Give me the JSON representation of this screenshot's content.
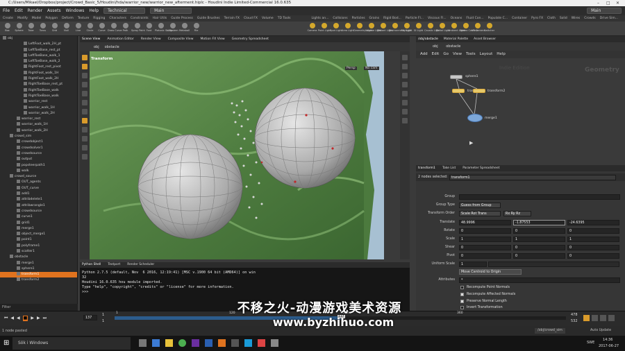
{
  "window": {
    "title": "C:/Users/Mikael/Dropbox/project/Crowd_Basic_5/Houdini/hda/warrior_new/warrior_new_afterment.hiplc - Houdini Indie Limited-Commercial 16.0.635"
  },
  "menubar": {
    "items": [
      "File",
      "Edit",
      "Render",
      "Assets",
      "Windows",
      "Help"
    ],
    "desktop": "Technical",
    "main": "Main",
    "right_main": "Main"
  },
  "shelf_tabs": [
    "Create",
    "Modify",
    "Model",
    "Polygon",
    "Deform",
    "Texture",
    "Rigging",
    "Characters",
    "Constraints",
    "Hair Utils",
    "Guide Process",
    "Guide Brushes",
    "Terrain FX",
    "Cloud FX",
    "Volume",
    "TD Tools",
    "Lights an...",
    "Collisions",
    "Particles",
    "Grains",
    "Rigid Bod...",
    "Particle Fl...",
    "Viscous Fl...",
    "Oceans",
    "Fluid Con...",
    "Populate C...",
    "Container",
    "Pyro FX",
    "Cloth",
    "Solid",
    "Wires",
    "Crowds",
    "Drive Sim..."
  ],
  "shelf_tools": [
    "Box",
    "Sphere",
    "Tube",
    "Torus",
    "Grid",
    "Null",
    "Line",
    "Circle",
    "Curve",
    "Draw Curve",
    "Path",
    "Spray Paint",
    "Font",
    "Platonic Solids",
    "L-System",
    "Metaball",
    "File"
  ],
  "light_tools": [
    "Camera",
    "Point Light",
    "Spot Light",
    "Area Light",
    "Geometry Light",
    "Volume Light",
    "Distant Light",
    "Environment Light",
    "Sky Light",
    "GI Light",
    "Caustic Light",
    "Portal Light",
    "Ambient Light",
    "Stereo Camera",
    "VR Camera",
    "Switcher"
  ],
  "tree": {
    "items": [
      {
        "label": "obj",
        "indent": 0
      },
      {
        "label": "LeftFoot_walk_2H_pt",
        "indent": 3
      },
      {
        "label": "LeftToeBase_rest_pt",
        "indent": 3
      },
      {
        "label": "LeftToeBase_walk_1",
        "indent": 3
      },
      {
        "label": "LeftToeBase_walk_2",
        "indent": 3
      },
      {
        "label": "RightFoot_rest_pivot",
        "indent": 3
      },
      {
        "label": "RightFoot_walk_1H",
        "indent": 3
      },
      {
        "label": "RightFoot_walk_2H",
        "indent": 3
      },
      {
        "label": "RightToeBase_rest_pt",
        "indent": 3
      },
      {
        "label": "RightToeBase_walk",
        "indent": 3
      },
      {
        "label": "RightToeBase_walk",
        "indent": 3
      },
      {
        "label": "warrior_rest",
        "indent": 3
      },
      {
        "label": "warrior_walk_1H",
        "indent": 3
      },
      {
        "label": "warrior_walk_2H",
        "indent": 3
      },
      {
        "label": "warrior_rest",
        "indent": 2
      },
      {
        "label": "warrior_walk_1H",
        "indent": 2
      },
      {
        "label": "warrior_walk_2H",
        "indent": 2
      },
      {
        "label": "crowd_sim",
        "indent": 1
      },
      {
        "label": "crowdobject1",
        "indent": 2
      },
      {
        "label": "crowdsolver1",
        "indent": 2
      },
      {
        "label": "crowdsource",
        "indent": 2
      },
      {
        "label": "output",
        "indent": 2
      },
      {
        "label": "popsteerpath1",
        "indent": 2
      },
      {
        "label": "walk",
        "indent": 2
      },
      {
        "label": "crowd_source",
        "indent": 1
      },
      {
        "label": "OUT_agents",
        "indent": 2
      },
      {
        "label": "OUT_curve",
        "indent": 2
      },
      {
        "label": "add1",
        "indent": 2
      },
      {
        "label": "attribdelete1",
        "indent": 2
      },
      {
        "label": "attribwrangle1",
        "indent": 2
      },
      {
        "label": "crowdsource",
        "indent": 2
      },
      {
        "label": "curve1",
        "indent": 2
      },
      {
        "label": "grid1",
        "indent": 2
      },
      {
        "label": "merge1",
        "indent": 2
      },
      {
        "label": "object_merge1",
        "indent": 2
      },
      {
        "label": "point1",
        "indent": 2
      },
      {
        "label": "polyframe1",
        "indent": 2
      },
      {
        "label": "scatter1",
        "indent": 2
      },
      {
        "label": "obstacle",
        "indent": 1
      },
      {
        "label": "merge1",
        "indent": 2
      },
      {
        "label": "sphere1",
        "indent": 2
      },
      {
        "label": "transform1",
        "indent": 2,
        "selected": true
      },
      {
        "label": "transform2",
        "indent": 2
      }
    ],
    "filter_label": "Filter"
  },
  "viewport": {
    "tabs": [
      "Scene View",
      "Animation Editor",
      "Render View",
      "Composite View",
      "Motion FX View",
      "Geometry Spreadsheet"
    ],
    "path": [
      "obj",
      "obstacle"
    ],
    "op_label": "Transform",
    "persp": "Persp",
    "cam": "No cam"
  },
  "python_shell": {
    "tabs": [
      "Python Shell",
      "Textport",
      "Render Scheduler"
    ],
    "lines": [
      "Python 2.7.5 (default, Nov  6 2016, 12:19:41) [MSC v.1900 64 bit (AMD64)] on win",
      "32",
      "Houdini 16.0.635 hou module imported.",
      "Type \"help\", \"copyright\", \"credits\" or \"license\" for more information.",
      ">>>"
    ]
  },
  "network": {
    "tabs": [
      "/obj/obstacle",
      "Material Palette",
      "Asset Browser"
    ],
    "path": [
      "obj",
      "obstacle"
    ],
    "menu": [
      "Add",
      "Edit",
      "Go",
      "View",
      "Tools",
      "Layout",
      "Help"
    ],
    "watermark_indie": "Indie Edition",
    "context_label": "Geometry",
    "nodes": {
      "sphere": "sphere1",
      "transform1": "transform1",
      "transform2": "transform2",
      "merge": "merge1"
    }
  },
  "params": {
    "tabs": [
      "transform1",
      "Take List",
      "Parameter Spreadsheet"
    ],
    "selected_count": "2 nodes selected:",
    "node_name": "transform1",
    "rows": {
      "group": "Group",
      "group_type": "Group Type",
      "group_type_value": "Guess from Group",
      "transform_order": "Transform Order",
      "transform_order_value": "Scale Rot Trans",
      "rot_order_value": "Rx Ry Rz",
      "translate": "Translate",
      "translate_x": "48.9996",
      "translate_y": "-1.87553",
      "translate_z": "-24.6395",
      "rotate": "Rotate",
      "rotate_vals": [
        "0",
        "0",
        "0"
      ],
      "scale": "Scale",
      "scale_vals": [
        "1",
        "1",
        "1"
      ],
      "shear": "Shear",
      "shear_vals": [
        "0",
        "0",
        "0"
      ],
      "pivot": "Pivot",
      "pivot_vals": [
        "0",
        "0",
        "0"
      ],
      "uniform_scale": "Uniform Scale",
      "uniform_scale_val": "1",
      "move_centroid": "Move Centroid to Origin",
      "attributes": "Attributes",
      "attributes_val": "*",
      "recompute_normals": "Recompute Point Normals",
      "recompute_affected": "Recompute Affected Normals",
      "preserve_normal": "Preserve Normal Length",
      "invert_transform": "Invert Transformation"
    }
  },
  "timeline": {
    "frame": "137",
    "start": "1",
    "range_start": "1",
    "ticks": [
      "1",
      "120",
      "240",
      "360"
    ],
    "current_marker": "137",
    "end1": "478",
    "end2": "532",
    "auto_update": "Auto Update",
    "obj_path": "/obj/crowd_sim"
  },
  "status": {
    "text": "1 node pasted"
  },
  "taskbar": {
    "search": "Sök i Windows",
    "lang": "SWE",
    "time": "14:36",
    "date": "2017-06-27"
  },
  "overlay": {
    "line1": "不移之火-动漫游戏美术资源",
    "line2": "www.byzhihuo.com"
  },
  "colors": {
    "accent": "#e0731f",
    "terrain": "#5b8a4a",
    "sky": "#a7c0d2"
  }
}
